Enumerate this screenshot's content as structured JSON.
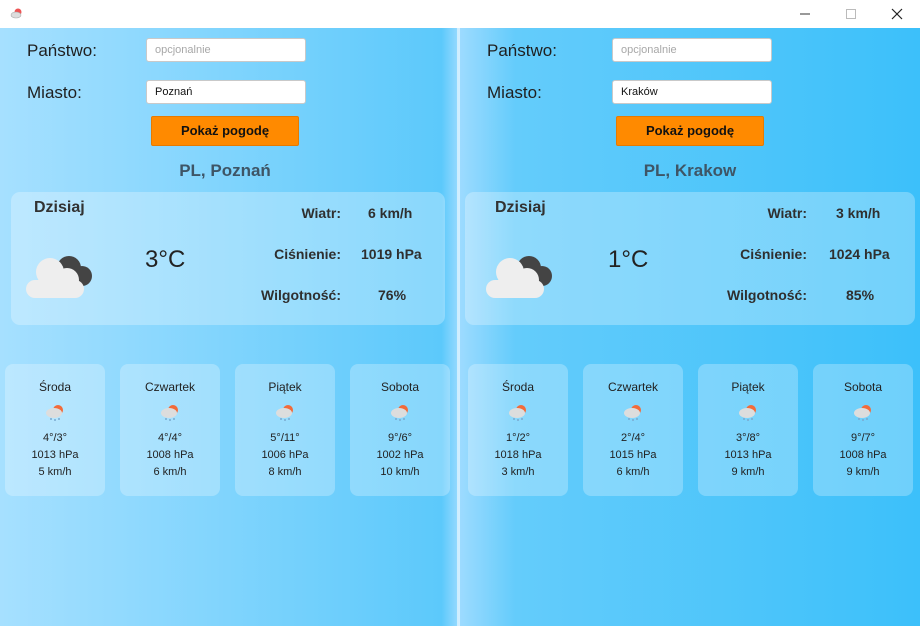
{
  "window": {
    "title": ""
  },
  "colors": {
    "accent": "#ff8a00"
  },
  "left": {
    "form": {
      "country_label": "Państwo:",
      "country_placeholder": "opcjonalnie",
      "country_value": "",
      "city_label": "Miasto:",
      "city_value": "Poznań",
      "button": "Pokaż pogodę"
    },
    "location": "PL, Poznań",
    "today": {
      "title": "Dzisiaj",
      "icon": "cloudy-icon",
      "temp": "3°C",
      "wind_label": "Wiatr:",
      "wind": "6 km/h",
      "pressure_label": "Ciśnienie:",
      "pressure": "1019 hPa",
      "humidity_label": "Wilgotność:",
      "humidity": "76%"
    },
    "forecast": [
      {
        "day": "Środa",
        "icon": "snow-sun-icon",
        "temp": "4°/3°",
        "pressure": "1013 hPa",
        "wind": "5 km/h"
      },
      {
        "day": "Czwartek",
        "icon": "snow-sun-icon",
        "temp": "4°/4°",
        "pressure": "1008 hPa",
        "wind": "6 km/h"
      },
      {
        "day": "Piątek",
        "icon": "snow-sun-icon",
        "temp": "5°/11°",
        "pressure": "1006 hPa",
        "wind": "8 km/h"
      },
      {
        "day": "Sobota",
        "icon": "snow-sun-icon",
        "temp": "9°/6°",
        "pressure": "1002 hPa",
        "wind": "10 km/h"
      }
    ]
  },
  "right": {
    "form": {
      "country_label": "Państwo:",
      "country_placeholder": "opcjonalnie",
      "country_value": "",
      "city_label": "Miasto:",
      "city_value": "Kraków",
      "button": "Pokaż pogodę"
    },
    "location": "PL, Krakow",
    "today": {
      "title": "Dzisiaj",
      "icon": "cloudy-icon",
      "temp": "1°C",
      "wind_label": "Wiatr:",
      "wind": "3 km/h",
      "pressure_label": "Ciśnienie:",
      "pressure": "1024 hPa",
      "humidity_label": "Wilgotność:",
      "humidity": "85%"
    },
    "forecast": [
      {
        "day": "Środa",
        "icon": "snow-sun-icon",
        "temp": "1°/2°",
        "pressure": "1018 hPa",
        "wind": "3 km/h"
      },
      {
        "day": "Czwartek",
        "icon": "snow-sun-icon",
        "temp": "2°/4°",
        "pressure": "1015 hPa",
        "wind": "6 km/h"
      },
      {
        "day": "Piątek",
        "icon": "snow-sun-icon",
        "temp": "3°/8°",
        "pressure": "1013 hPa",
        "wind": "9 km/h"
      },
      {
        "day": "Sobota",
        "icon": "snow-sun-icon",
        "temp": "9°/7°",
        "pressure": "1008 hPa",
        "wind": "9 km/h"
      }
    ]
  }
}
